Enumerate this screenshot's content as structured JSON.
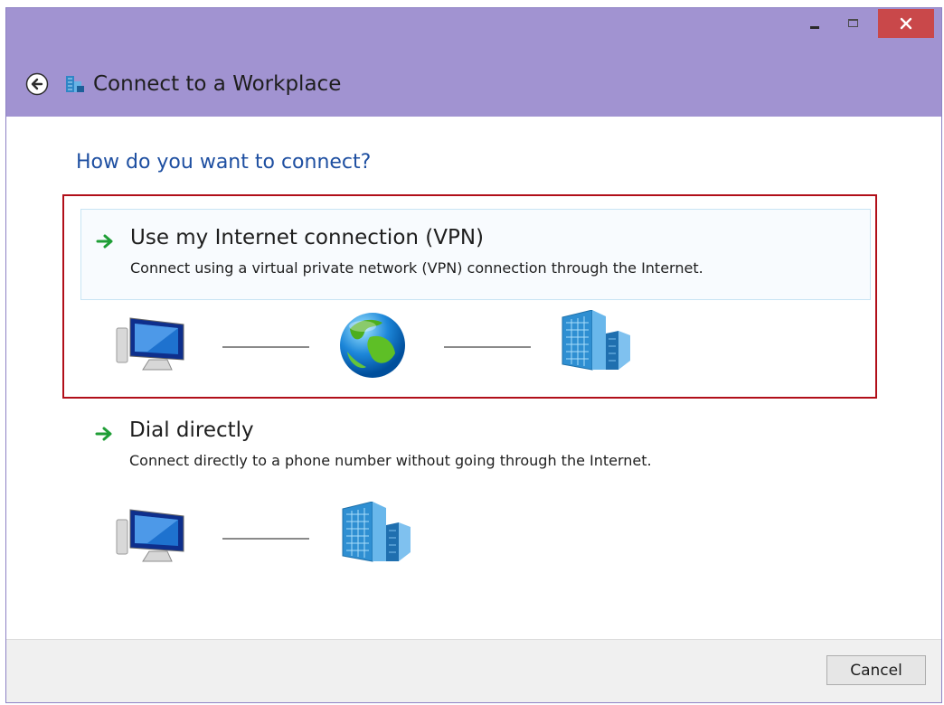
{
  "window": {
    "title": "Connect to a Workplace"
  },
  "prompt": "How do you want to connect?",
  "options": [
    {
      "title": "Use my Internet connection (VPN)",
      "description": "Connect using a virtual private network (VPN) connection through the Internet.",
      "selected": true,
      "diagram": [
        "computer-icon",
        "globe-icon",
        "building-icon"
      ]
    },
    {
      "title": "Dial directly",
      "description": "Connect directly to a phone number without going through the Internet.",
      "selected": false,
      "diagram": [
        "computer-icon",
        "building-icon"
      ]
    }
  ],
  "footer": {
    "cancel_label": "Cancel"
  },
  "colors": {
    "titlebar": "#a193d1",
    "heading": "#1e4fa1",
    "highlight_border": "#b10f19",
    "close_button": "#c9484a",
    "arrow": "#1f9e36"
  }
}
